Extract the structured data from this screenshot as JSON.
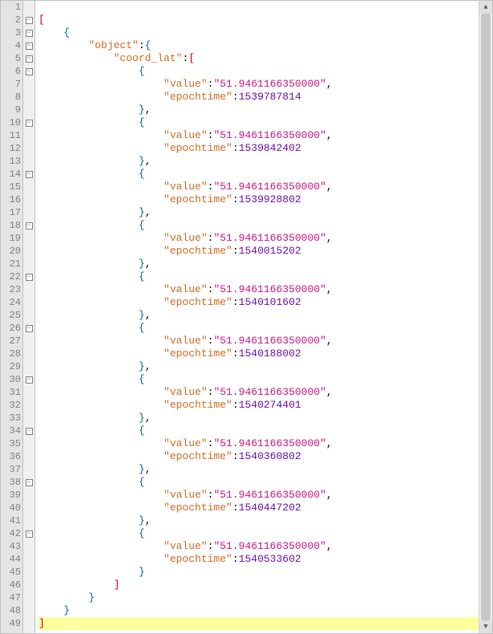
{
  "editor": {
    "highlighted_line": 49,
    "fold_lines": [
      2,
      3,
      4,
      5,
      6,
      10,
      14,
      18,
      22,
      26,
      30,
      34,
      38,
      42
    ],
    "lines": [
      {
        "n": 1,
        "indent": 0,
        "tokens": []
      },
      {
        "n": 2,
        "indent": 0,
        "tokens": [
          {
            "t": "bracket",
            "v": "["
          }
        ]
      },
      {
        "n": 3,
        "indent": 1,
        "tokens": [
          {
            "t": "brace",
            "v": "{"
          }
        ]
      },
      {
        "n": 4,
        "indent": 2,
        "tokens": [
          {
            "t": "key",
            "v": "\"object\""
          },
          {
            "t": "punct",
            "v": ":"
          },
          {
            "t": "brace",
            "v": "{"
          }
        ]
      },
      {
        "n": 5,
        "indent": 3,
        "tokens": [
          {
            "t": "key",
            "v": "\"coord_lat\""
          },
          {
            "t": "punct",
            "v": ":"
          },
          {
            "t": "bracket",
            "v": "["
          }
        ]
      },
      {
        "n": 6,
        "indent": 4,
        "tokens": [
          {
            "t": "brace",
            "v": "{"
          }
        ]
      },
      {
        "n": 7,
        "indent": 5,
        "tokens": [
          {
            "t": "key",
            "v": "\"value\""
          },
          {
            "t": "punct",
            "v": ":"
          },
          {
            "t": "strval",
            "v": "\"51.9461166350000\""
          },
          {
            "t": "punct",
            "v": ","
          }
        ]
      },
      {
        "n": 8,
        "indent": 5,
        "tokens": [
          {
            "t": "key",
            "v": "\"epochtime\""
          },
          {
            "t": "punct",
            "v": ":"
          },
          {
            "t": "numval",
            "v": "1539787814"
          }
        ]
      },
      {
        "n": 9,
        "indent": 4,
        "tokens": [
          {
            "t": "brace",
            "v": "}"
          },
          {
            "t": "punct",
            "v": ","
          }
        ]
      },
      {
        "n": 10,
        "indent": 4,
        "tokens": [
          {
            "t": "brace",
            "v": "{"
          }
        ]
      },
      {
        "n": 11,
        "indent": 5,
        "tokens": [
          {
            "t": "key",
            "v": "\"value\""
          },
          {
            "t": "punct",
            "v": ":"
          },
          {
            "t": "strval",
            "v": "\"51.9461166350000\""
          },
          {
            "t": "punct",
            "v": ","
          }
        ]
      },
      {
        "n": 12,
        "indent": 5,
        "tokens": [
          {
            "t": "key",
            "v": "\"epochtime\""
          },
          {
            "t": "punct",
            "v": ":"
          },
          {
            "t": "numval",
            "v": "1539842402"
          }
        ]
      },
      {
        "n": 13,
        "indent": 4,
        "tokens": [
          {
            "t": "brace",
            "v": "}"
          },
          {
            "t": "punct",
            "v": ","
          }
        ]
      },
      {
        "n": 14,
        "indent": 4,
        "tokens": [
          {
            "t": "brace",
            "v": "{"
          }
        ]
      },
      {
        "n": 15,
        "indent": 5,
        "tokens": [
          {
            "t": "key",
            "v": "\"value\""
          },
          {
            "t": "punct",
            "v": ":"
          },
          {
            "t": "strval",
            "v": "\"51.9461166350000\""
          },
          {
            "t": "punct",
            "v": ","
          }
        ]
      },
      {
        "n": 16,
        "indent": 5,
        "tokens": [
          {
            "t": "key",
            "v": "\"epochtime\""
          },
          {
            "t": "punct",
            "v": ":"
          },
          {
            "t": "numval",
            "v": "1539928802"
          }
        ]
      },
      {
        "n": 17,
        "indent": 4,
        "tokens": [
          {
            "t": "brace",
            "v": "}"
          },
          {
            "t": "punct",
            "v": ","
          }
        ]
      },
      {
        "n": 18,
        "indent": 4,
        "tokens": [
          {
            "t": "brace",
            "v": "{"
          }
        ]
      },
      {
        "n": 19,
        "indent": 5,
        "tokens": [
          {
            "t": "key",
            "v": "\"value\""
          },
          {
            "t": "punct",
            "v": ":"
          },
          {
            "t": "strval",
            "v": "\"51.9461166350000\""
          },
          {
            "t": "punct",
            "v": ","
          }
        ]
      },
      {
        "n": 20,
        "indent": 5,
        "tokens": [
          {
            "t": "key",
            "v": "\"epochtime\""
          },
          {
            "t": "punct",
            "v": ":"
          },
          {
            "t": "numval",
            "v": "1540015202"
          }
        ]
      },
      {
        "n": 21,
        "indent": 4,
        "tokens": [
          {
            "t": "brace",
            "v": "}"
          },
          {
            "t": "punct",
            "v": ","
          }
        ]
      },
      {
        "n": 22,
        "indent": 4,
        "tokens": [
          {
            "t": "brace",
            "v": "{"
          }
        ]
      },
      {
        "n": 23,
        "indent": 5,
        "tokens": [
          {
            "t": "key",
            "v": "\"value\""
          },
          {
            "t": "punct",
            "v": ":"
          },
          {
            "t": "strval",
            "v": "\"51.9461166350000\""
          },
          {
            "t": "punct",
            "v": ","
          }
        ]
      },
      {
        "n": 24,
        "indent": 5,
        "tokens": [
          {
            "t": "key",
            "v": "\"epochtime\""
          },
          {
            "t": "punct",
            "v": ":"
          },
          {
            "t": "numval",
            "v": "1540101602"
          }
        ]
      },
      {
        "n": 25,
        "indent": 4,
        "tokens": [
          {
            "t": "brace",
            "v": "}"
          },
          {
            "t": "punct",
            "v": ","
          }
        ]
      },
      {
        "n": 26,
        "indent": 4,
        "tokens": [
          {
            "t": "brace",
            "v": "{"
          }
        ]
      },
      {
        "n": 27,
        "indent": 5,
        "tokens": [
          {
            "t": "key",
            "v": "\"value\""
          },
          {
            "t": "punct",
            "v": ":"
          },
          {
            "t": "strval",
            "v": "\"51.9461166350000\""
          },
          {
            "t": "punct",
            "v": ","
          }
        ]
      },
      {
        "n": 28,
        "indent": 5,
        "tokens": [
          {
            "t": "key",
            "v": "\"epochtime\""
          },
          {
            "t": "punct",
            "v": ":"
          },
          {
            "t": "numval",
            "v": "1540188002"
          }
        ]
      },
      {
        "n": 29,
        "indent": 4,
        "tokens": [
          {
            "t": "brace",
            "v": "}"
          },
          {
            "t": "punct",
            "v": ","
          }
        ]
      },
      {
        "n": 30,
        "indent": 4,
        "tokens": [
          {
            "t": "brace",
            "v": "{"
          }
        ]
      },
      {
        "n": 31,
        "indent": 5,
        "tokens": [
          {
            "t": "key",
            "v": "\"value\""
          },
          {
            "t": "punct",
            "v": ":"
          },
          {
            "t": "strval",
            "v": "\"51.9461166350000\""
          },
          {
            "t": "punct",
            "v": ","
          }
        ]
      },
      {
        "n": 32,
        "indent": 5,
        "tokens": [
          {
            "t": "key",
            "v": "\"epochtime\""
          },
          {
            "t": "punct",
            "v": ":"
          },
          {
            "t": "numval",
            "v": "1540274401"
          }
        ]
      },
      {
        "n": 33,
        "indent": 4,
        "tokens": [
          {
            "t": "brace",
            "v": "}"
          },
          {
            "t": "punct",
            "v": ","
          }
        ]
      },
      {
        "n": 34,
        "indent": 4,
        "tokens": [
          {
            "t": "brace",
            "v": "{"
          }
        ]
      },
      {
        "n": 35,
        "indent": 5,
        "tokens": [
          {
            "t": "key",
            "v": "\"value\""
          },
          {
            "t": "punct",
            "v": ":"
          },
          {
            "t": "strval",
            "v": "\"51.9461166350000\""
          },
          {
            "t": "punct",
            "v": ","
          }
        ]
      },
      {
        "n": 36,
        "indent": 5,
        "tokens": [
          {
            "t": "key",
            "v": "\"epochtime\""
          },
          {
            "t": "punct",
            "v": ":"
          },
          {
            "t": "numval",
            "v": "1540360802"
          }
        ]
      },
      {
        "n": 37,
        "indent": 4,
        "tokens": [
          {
            "t": "brace",
            "v": "}"
          },
          {
            "t": "punct",
            "v": ","
          }
        ]
      },
      {
        "n": 38,
        "indent": 4,
        "tokens": [
          {
            "t": "brace",
            "v": "{"
          }
        ]
      },
      {
        "n": 39,
        "indent": 5,
        "tokens": [
          {
            "t": "key",
            "v": "\"value\""
          },
          {
            "t": "punct",
            "v": ":"
          },
          {
            "t": "strval",
            "v": "\"51.9461166350000\""
          },
          {
            "t": "punct",
            "v": ","
          }
        ]
      },
      {
        "n": 40,
        "indent": 5,
        "tokens": [
          {
            "t": "key",
            "v": "\"epochtime\""
          },
          {
            "t": "punct",
            "v": ":"
          },
          {
            "t": "numval",
            "v": "1540447202"
          }
        ]
      },
      {
        "n": 41,
        "indent": 4,
        "tokens": [
          {
            "t": "brace",
            "v": "}"
          },
          {
            "t": "punct",
            "v": ","
          }
        ]
      },
      {
        "n": 42,
        "indent": 4,
        "tokens": [
          {
            "t": "brace",
            "v": "{"
          }
        ]
      },
      {
        "n": 43,
        "indent": 5,
        "tokens": [
          {
            "t": "key",
            "v": "\"value\""
          },
          {
            "t": "punct",
            "v": ":"
          },
          {
            "t": "strval",
            "v": "\"51.9461166350000\""
          },
          {
            "t": "punct",
            "v": ","
          }
        ]
      },
      {
        "n": 44,
        "indent": 5,
        "tokens": [
          {
            "t": "key",
            "v": "\"epochtime\""
          },
          {
            "t": "punct",
            "v": ":"
          },
          {
            "t": "numval",
            "v": "1540533602"
          }
        ]
      },
      {
        "n": 45,
        "indent": 4,
        "tokens": [
          {
            "t": "brace",
            "v": "}"
          }
        ]
      },
      {
        "n": 46,
        "indent": 3,
        "tokens": [
          {
            "t": "bracket",
            "v": "]"
          }
        ]
      },
      {
        "n": 47,
        "indent": 2,
        "tokens": [
          {
            "t": "brace",
            "v": "}"
          }
        ]
      },
      {
        "n": 48,
        "indent": 1,
        "tokens": [
          {
            "t": "brace",
            "v": "}"
          }
        ]
      },
      {
        "n": 49,
        "indent": 0,
        "tokens": [
          {
            "t": "bracket",
            "v": "]"
          }
        ]
      }
    ]
  }
}
